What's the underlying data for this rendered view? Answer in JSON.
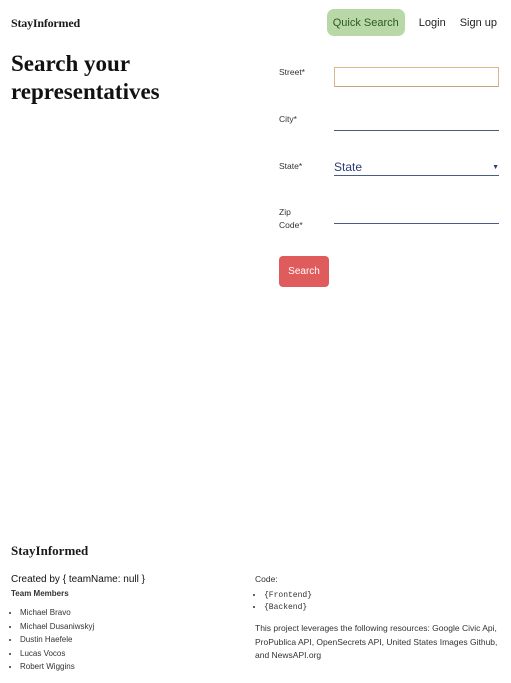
{
  "header": {
    "brand": "StayInformed",
    "quick_search": "Quick Search",
    "login": "Login",
    "signup": "Sign up"
  },
  "main": {
    "title": "Search your representatives",
    "fields": {
      "street_label": "Street*",
      "city_label": "City*",
      "state_label": "State*",
      "state_value": "State",
      "zip_label": "Zip Code*"
    },
    "search_label": "Search"
  },
  "footer": {
    "brand": "StayInformed",
    "created_by": "Created by { teamName: null }",
    "team_title": "Team Members",
    "members": [
      "Michael Bravo",
      "Michael Dusaniwskyj",
      "Dustin Haefele",
      "Lucas Vocos",
      "Robert Wiggins"
    ],
    "code_title": "Code:",
    "code_items": [
      "{Frontend}",
      "{Backend}"
    ],
    "resources": "This project leverages the following resources: Google Civic Api, ProPublica API, OpenSecrets API, United States Images Github, and NewsAPI.org"
  }
}
